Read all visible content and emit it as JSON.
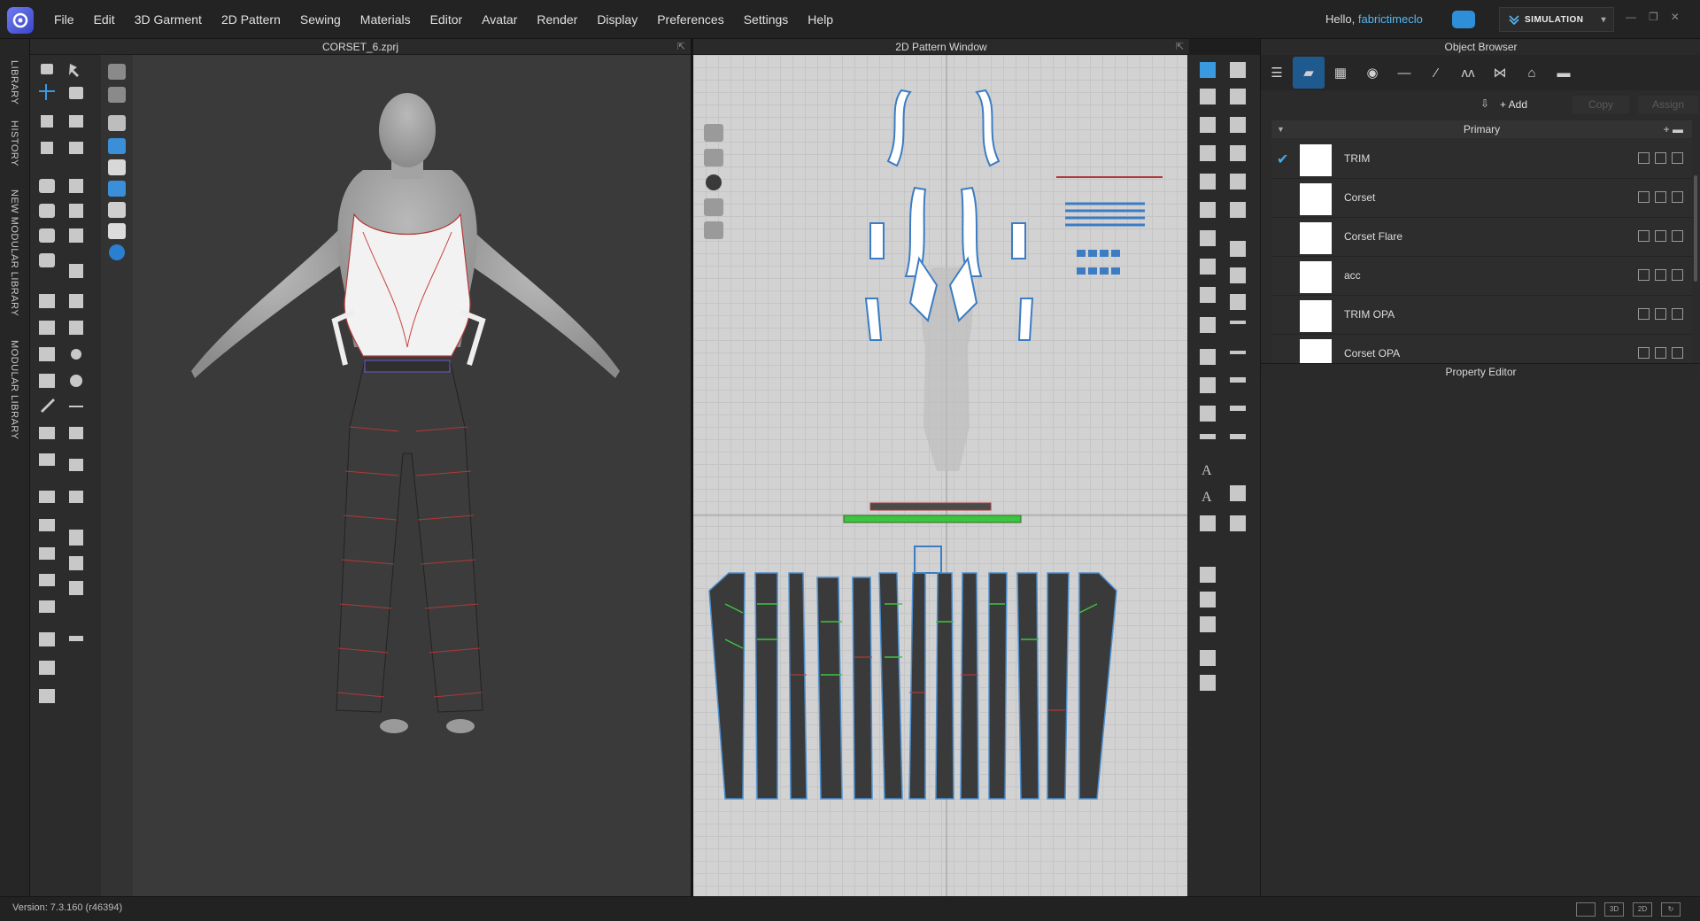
{
  "menubar": {
    "items": [
      "File",
      "Edit",
      "3D Garment",
      "2D Pattern",
      "Sewing",
      "Materials",
      "Editor",
      "Avatar",
      "Render",
      "Display",
      "Preferences",
      "Settings",
      "Help"
    ],
    "greeting": "Hello,",
    "username": "fabrictimeclo",
    "mode_button": "SIMULATION"
  },
  "sidebar": {
    "tabs": [
      "LIBRARY",
      "HISTORY",
      "NEW MODULAR LIBRARY",
      "MODULAR LIBRARY"
    ]
  },
  "panel3d": {
    "title": "CORSET_6.zprj"
  },
  "panel2d": {
    "title": "2D Pattern Window"
  },
  "object_browser": {
    "title": "Object Browser",
    "add_label": "+ Add",
    "copy_label": "Copy",
    "assign_label": "Assign",
    "group_label": "Primary",
    "materials": [
      {
        "name": "TRIM",
        "selected": true
      },
      {
        "name": "Corset",
        "selected": false
      },
      {
        "name": "Corset Flare",
        "selected": false
      },
      {
        "name": "acc",
        "selected": false
      },
      {
        "name": "TRIM OPA",
        "selected": false
      },
      {
        "name": "Corset OPA",
        "selected": false
      }
    ]
  },
  "property_editor": {
    "title": "Property Editor"
  },
  "status": {
    "version": "Version: 7.3.160 (r46394)"
  },
  "colors": {
    "accent": "#1f5a8f",
    "check": "#4aa8e8",
    "seam_green": "#3ec43e",
    "seam_red": "#c63a3a",
    "pattern_outline": "#4b8fd1"
  }
}
